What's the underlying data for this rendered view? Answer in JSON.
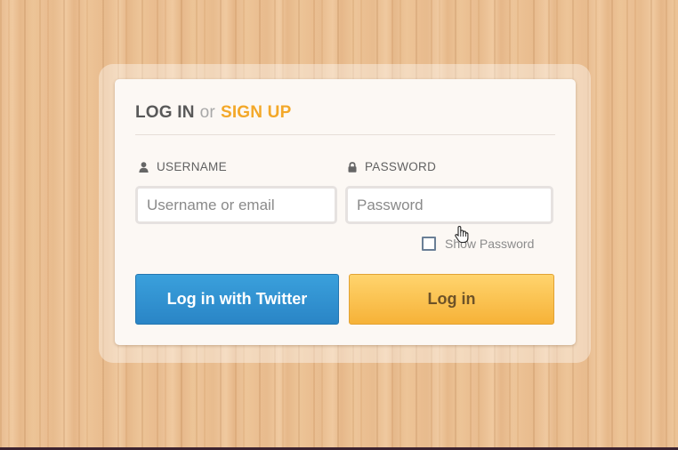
{
  "header": {
    "login_label": "LOG IN",
    "or_label": "or",
    "signup_label": "SIGN UP"
  },
  "username": {
    "label": "USERNAME",
    "placeholder": "Username or email",
    "value": "",
    "icon": "user-icon"
  },
  "password": {
    "label": "PASSWORD",
    "placeholder": "Password",
    "value": "",
    "icon": "lock-icon"
  },
  "show_password": {
    "label": "Show Password",
    "checked": false
  },
  "buttons": {
    "twitter_label": "Log in with Twitter",
    "login_label": "Log in"
  },
  "colors": {
    "accent": "#f3a829",
    "twitter_blue": "#2a85c6",
    "login_yellow": "#f6b238"
  }
}
